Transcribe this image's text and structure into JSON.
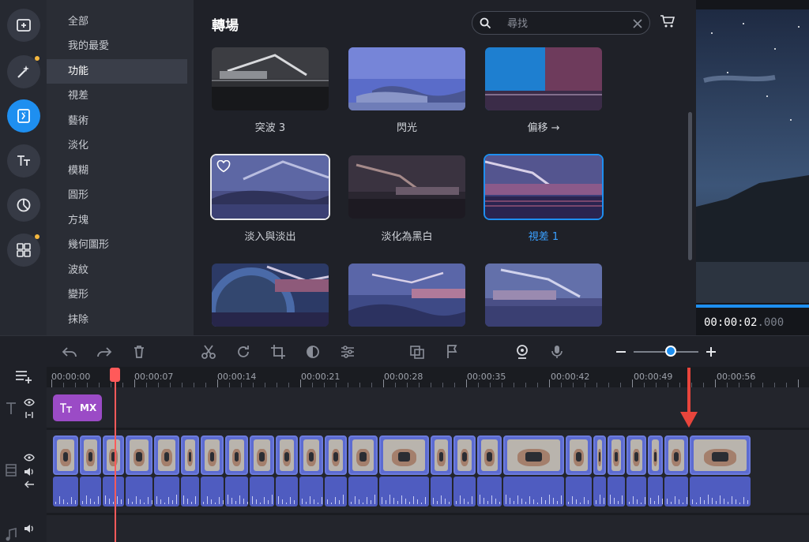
{
  "categories": [
    {
      "label": "全部",
      "active": false
    },
    {
      "label": "我的最愛",
      "active": false
    },
    {
      "label": "功能",
      "active": true
    },
    {
      "label": "視差",
      "active": false
    },
    {
      "label": "藝術",
      "active": false
    },
    {
      "label": "淡化",
      "active": false
    },
    {
      "label": "模糊",
      "active": false
    },
    {
      "label": "圓形",
      "active": false
    },
    {
      "label": "方塊",
      "active": false
    },
    {
      "label": "幾何圖形",
      "active": false
    },
    {
      "label": "波紋",
      "active": false
    },
    {
      "label": "變形",
      "active": false
    },
    {
      "label": "抹除",
      "active": false
    }
  ],
  "panel": {
    "title": "轉場",
    "search_placeholder": "尋找",
    "tiles": [
      {
        "label": "突波 3"
      },
      {
        "label": "閃光"
      },
      {
        "label": "偏移 →"
      },
      {
        "label": "淡入與淡出"
      },
      {
        "label": "淡化為黑白"
      },
      {
        "label": "視差 1"
      },
      {
        "label": ""
      },
      {
        "label": ""
      },
      {
        "label": ""
      }
    ]
  },
  "preview": {
    "time_main": "00:00:02",
    "time_ms": ".000"
  },
  "timeline": {
    "ticks": [
      "00:00:00",
      "00:00:07",
      "00:00:14",
      "00:00:21",
      "00:00:28",
      "00:00:35",
      "00:00:42",
      "00:00:49",
      "00:00:56"
    ],
    "title_clip_label": "MX"
  },
  "colors": {
    "accent": "#1e8ff0",
    "playhead": "#ff5a5a",
    "title_clip": "#9b4bc6",
    "video_clip": "#5c6bd1",
    "notification": "#f4b73f"
  },
  "icons": {
    "rail": [
      "add-media-icon",
      "magic-wand-icon",
      "transitions-icon",
      "titles-icon",
      "stickers-icon",
      "more-tools-icon"
    ],
    "toolbar": [
      "undo-icon",
      "redo-icon",
      "delete-icon",
      "cut-icon",
      "rotate-icon",
      "crop-icon",
      "color-icon",
      "adjust-icon",
      "overlay-icon",
      "marker-icon",
      "webcam-icon",
      "microphone-icon",
      "zoom-out-icon",
      "zoom-in-icon"
    ]
  }
}
